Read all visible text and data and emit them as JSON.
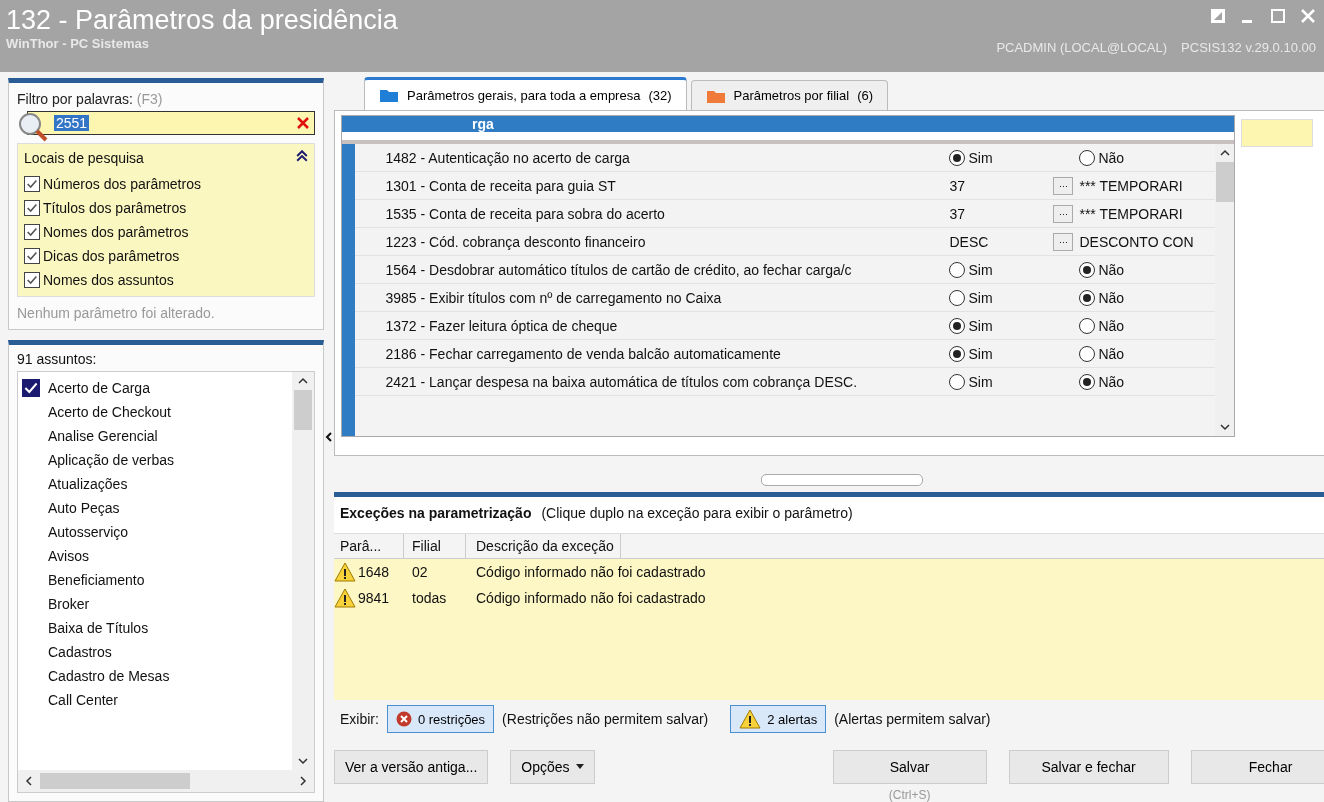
{
  "window": {
    "title": "132 - Parâmetros da presidência",
    "subtitle": "WinThor - PC Sistemas",
    "user": "PCADMIN (LOCAL@LOCAL)",
    "version": "PCSIS132  v.29.0.10.00"
  },
  "filter": {
    "label": "Filtro por palavras:",
    "shortcut": "(F3)",
    "value": "2551",
    "locations_title": "Locais de pesquisa",
    "locations": [
      {
        "label": "Números dos parâmetros",
        "checked": true
      },
      {
        "label": "Títulos dos parâmetros",
        "checked": true
      },
      {
        "label": "Nomes dos parâmetros",
        "checked": true
      },
      {
        "label": "Dicas dos parâmetros",
        "checked": true
      },
      {
        "label": "Nomes dos assuntos",
        "checked": true
      }
    ],
    "status": "Nenhum parâmetro foi alterado."
  },
  "subjects": {
    "title": "91 assuntos:",
    "items": [
      {
        "label": "Acerto de Carga",
        "checked": true
      },
      {
        "label": "Acerto de Checkout",
        "checked": false
      },
      {
        "label": "Analise Gerencial",
        "checked": false
      },
      {
        "label": "Aplicação de verbas",
        "checked": false
      },
      {
        "label": "Atualizações",
        "checked": false
      },
      {
        "label": "Auto Peças",
        "checked": false
      },
      {
        "label": "Autosserviço",
        "checked": false
      },
      {
        "label": "Avisos",
        "checked": false
      },
      {
        "label": "Beneficiamento",
        "checked": false
      },
      {
        "label": "Broker",
        "checked": false
      },
      {
        "label": "Baixa de Títulos",
        "checked": false
      },
      {
        "label": "Cadastros",
        "checked": false
      },
      {
        "label": "Cadastro de Mesas",
        "checked": false
      },
      {
        "label": "Call Center",
        "checked": false
      }
    ]
  },
  "tabs": [
    {
      "label": "Parâmetros gerais, para toda a empresa",
      "count": "(32)",
      "selected": true
    },
    {
      "label": "Parâmetros por filial",
      "count": "(6)",
      "selected": false
    }
  ],
  "grid": {
    "group": "rga",
    "rows": [
      {
        "kind": "radio",
        "name": "1482 - Autenticação no acerto de carga",
        "options": [
          {
            "label": "Sim",
            "selected": true
          },
          {
            "label": "Não",
            "selected": false
          }
        ]
      },
      {
        "kind": "lookup",
        "name": "1301 - Conta de receita para guia ST",
        "code": "37",
        "button": "···",
        "description": "*** TEMPORARI"
      },
      {
        "kind": "lookup",
        "name": "1535 - Conta de receita para sobra do acerto",
        "code": "37",
        "button": "···",
        "description": "*** TEMPORARI"
      },
      {
        "kind": "lookup",
        "name": "1223 - Cód. cobrança desconto financeiro",
        "code": "DESC",
        "button": "···",
        "description": "DESCONTO CON"
      },
      {
        "kind": "radio",
        "name": "1564 - Desdobrar automático títulos de cartão de crédito, ao fechar carga/c",
        "options": [
          {
            "label": "Sim",
            "selected": false
          },
          {
            "label": "Não",
            "selected": true
          }
        ]
      },
      {
        "kind": "radio",
        "name": "3985 - Exibir títulos com nº de carregamento no Caixa",
        "options": [
          {
            "label": "Sim",
            "selected": false
          },
          {
            "label": "Não",
            "selected": true
          }
        ]
      },
      {
        "kind": "radio",
        "name": "1372 - Fazer leitura óptica de cheque",
        "options": [
          {
            "label": "Sim",
            "selected": true
          },
          {
            "label": "Não",
            "selected": false
          }
        ]
      },
      {
        "kind": "radio",
        "name": "2186 - Fechar carregamento de venda balcão automaticamente",
        "options": [
          {
            "label": "Sim",
            "selected": true
          },
          {
            "label": "Não",
            "selected": false
          }
        ]
      },
      {
        "kind": "radio",
        "name": "2421 - Lançar despesa na baixa automática de títulos com cobrança DESC.",
        "options": [
          {
            "label": "Sim",
            "selected": false
          },
          {
            "label": "Não",
            "selected": true
          }
        ]
      }
    ]
  },
  "exceptions": {
    "title": "Exceções na parametrização",
    "hint": "(Clique duplo na exceção para exibir o parâmetro)",
    "columns": [
      "Parâ...",
      "Filial",
      "Descrição da exceção"
    ],
    "rows": [
      {
        "param": "1648",
        "branch": "02",
        "description": "Código informado não foi cadastrado"
      },
      {
        "param": "9841",
        "branch": "todas",
        "description": "Código informado não foi cadastrado"
      }
    ],
    "show_label": "Exibir:",
    "restrictions": {
      "label": "0 restrições",
      "note": "(Restrições não permitem salvar)"
    },
    "alerts": {
      "label": "2 alertas",
      "note": "(Alertas permitem salvar)"
    }
  },
  "buttons": {
    "old_version": "Ver a versão antiga...",
    "options": "Opções",
    "save": "Salvar",
    "save_shortcut": "(Ctrl+S)",
    "save_close": "Salvar e fechar",
    "close": "Fechar"
  }
}
